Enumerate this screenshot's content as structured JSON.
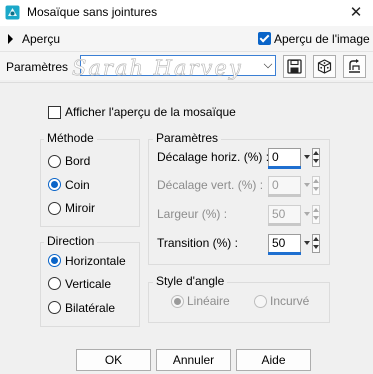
{
  "window": {
    "title": "Mosaïque sans jointures",
    "close_glyph": "✕",
    "icon": "app-logo-icon"
  },
  "preview": {
    "expand_label": "Aperçu",
    "image_preview_label": "Aperçu de l'image",
    "image_preview_checked": true
  },
  "presets": {
    "label": "Paramètres",
    "value": "",
    "watermark_text": "Sarah Harvey",
    "buttons": [
      "save-preset-icon",
      "randomize-dice-icon",
      "reset-default-icon"
    ]
  },
  "show_mosaic_preview": {
    "label": "Afficher l'aperçu de la mosaïque",
    "checked": false
  },
  "method": {
    "title": "Méthode",
    "options": [
      {
        "label": "Bord",
        "checked": false
      },
      {
        "label": "Coin",
        "checked": true
      },
      {
        "label": "Miroir",
        "checked": false
      }
    ]
  },
  "direction": {
    "title": "Direction",
    "options": [
      {
        "label": "Horizontale",
        "checked": true
      },
      {
        "label": "Verticale",
        "checked": false
      },
      {
        "label": "Bilatérale",
        "checked": false
      }
    ]
  },
  "parameters": {
    "title": "Paramètres",
    "fields": [
      {
        "label": "Décalage horiz. (%) :",
        "value": "0",
        "disabled": false
      },
      {
        "label": "Décalage vert. (%) :",
        "value": "0",
        "disabled": true
      },
      {
        "label": "Largeur (%) :",
        "value": "50",
        "disabled": true
      },
      {
        "label": "Transition (%) :",
        "value": "50",
        "disabled": false
      }
    ]
  },
  "corner_style": {
    "title": "Style d'angle",
    "options": [
      {
        "label": "Linéaire",
        "checked": true,
        "disabled": true
      },
      {
        "label": "Incurvé",
        "checked": false,
        "disabled": true
      }
    ]
  },
  "buttons": {
    "ok": "OK",
    "cancel": "Annuler",
    "help": "Aide"
  },
  "colors": {
    "accent": "#0a64c8",
    "background": "#f0f0f0"
  }
}
